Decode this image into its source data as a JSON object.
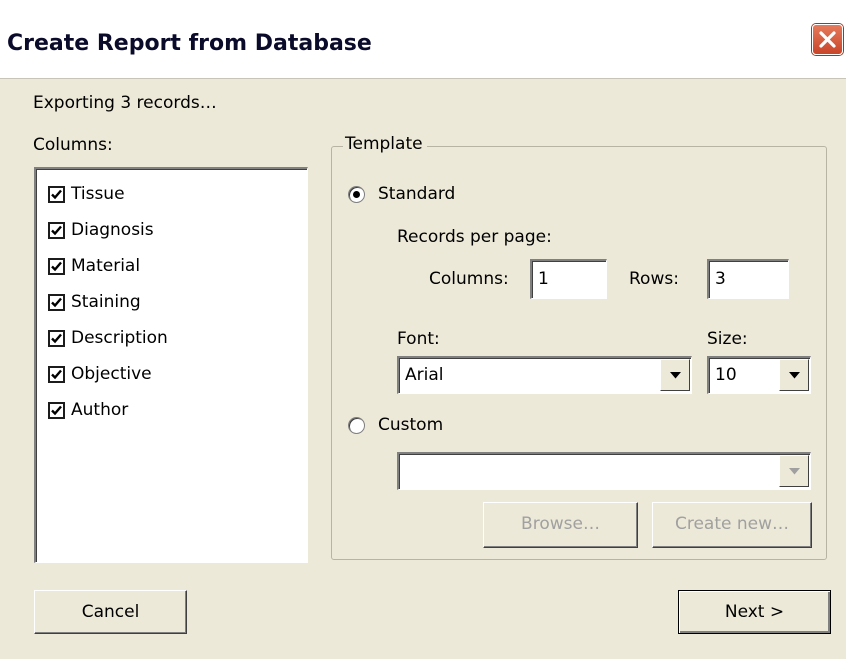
{
  "window": {
    "title": "Create Report from Database"
  },
  "status": "Exporting 3 records…",
  "columns": {
    "label": "Columns:",
    "items": [
      {
        "label": "Tissue",
        "checked": true
      },
      {
        "label": "Diagnosis",
        "checked": true
      },
      {
        "label": "Material",
        "checked": true
      },
      {
        "label": "Staining",
        "checked": true
      },
      {
        "label": "Description",
        "checked": true
      },
      {
        "label": "Objective",
        "checked": true
      },
      {
        "label": "Author",
        "checked": true
      }
    ]
  },
  "template": {
    "legend": "Template",
    "standard": {
      "label": "Standard",
      "selected": true,
      "records_per_page_label": "Records per page:",
      "columns_label": "Columns:",
      "columns_value": "1",
      "rows_label": "Rows:",
      "rows_value": "3",
      "font_label": "Font:",
      "font_value": "Arial",
      "size_label": "Size:",
      "size_value": "10"
    },
    "custom": {
      "label": "Custom",
      "selected": false,
      "combo_value": "",
      "browse_label": "Browse…",
      "create_new_label": "Create new…"
    }
  },
  "buttons": {
    "cancel": "Cancel",
    "next": "Next >"
  },
  "colors": {
    "close_button": "#d9553a",
    "title_text": "#0a0a2a",
    "dialog_bg": "#ece9d8"
  },
  "icons": {
    "close": "close-x-icon",
    "checkbox": "checkmark-icon",
    "dropdown": "chevron-down-icon"
  }
}
